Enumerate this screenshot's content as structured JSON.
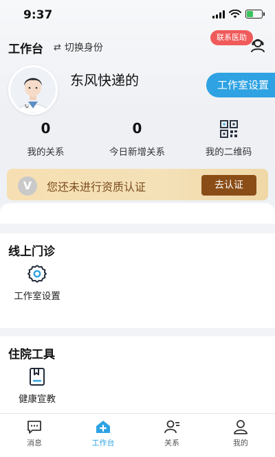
{
  "status_bar": {
    "time": "9:37"
  },
  "header": {
    "title": "工作台",
    "switch_label": "切换身份",
    "contact_badge": "联系医助"
  },
  "profile": {
    "name": "东风快递的",
    "studio_button": "工作室设置"
  },
  "stats": [
    {
      "value": "0",
      "label": "我的关系"
    },
    {
      "value": "0",
      "label": "今日新增关系"
    },
    {
      "value": "",
      "label": "我的二维码",
      "icon": "qr-code-icon"
    }
  ],
  "certification": {
    "message": "您还未进行资质认证",
    "button": "去认证",
    "badge_letter": "V"
  },
  "sections": [
    {
      "title": "线上门诊",
      "tools": [
        {
          "label": "工作室设置",
          "icon": "gear-icon"
        }
      ]
    },
    {
      "title": "住院工具",
      "tools": [
        {
          "label": "健康宣教",
          "icon": "bookmark-book-icon"
        }
      ]
    }
  ],
  "tabbar": [
    {
      "label": "消息",
      "icon": "message-icon",
      "active": false
    },
    {
      "label": "工作台",
      "icon": "home-plus-icon",
      "active": true
    },
    {
      "label": "关系",
      "icon": "relations-icon",
      "active": false
    },
    {
      "label": "我的",
      "icon": "profile-icon",
      "active": false
    }
  ],
  "colors": {
    "accent": "#2ea2e2",
    "badge_red": "#f05a5a",
    "cert_button": "#8b4d17",
    "cert_text": "#7a4b1d",
    "battery_green": "#3ac35c"
  }
}
